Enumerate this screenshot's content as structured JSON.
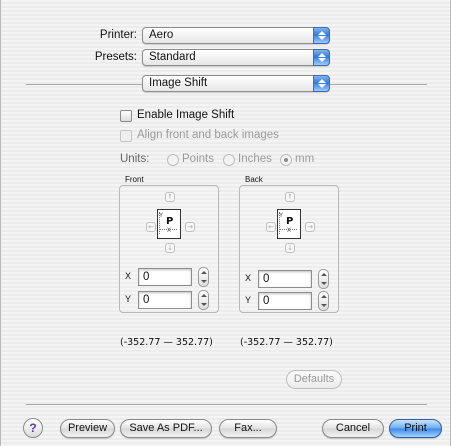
{
  "header": {
    "printer_label": "Printer:",
    "printer_value": "Aero",
    "presets_label": "Presets:",
    "presets_value": "Standard",
    "panel_value": "Image Shift"
  },
  "options": {
    "enable_label": "Enable Image Shift",
    "align_label": "Align front and back images",
    "units_label": "Units:",
    "units": [
      "Points",
      "Inches",
      "mm"
    ],
    "selected_unit": "mm"
  },
  "front": {
    "title": "Front",
    "x_label": "X",
    "x_value": "0",
    "y_label": "Y",
    "y_value": "0",
    "range": "(-352.77  —  352.77)"
  },
  "back": {
    "title": "Back",
    "x_label": "X",
    "x_value": "0",
    "y_label": "Y",
    "y_value": "0",
    "range": "(-352.77  —  352.77)"
  },
  "preview_glyphs": {
    "page_letter": "P",
    "y_axis": "Y",
    "x_axis": "X",
    "up": "↑",
    "down": "↓",
    "left": "←",
    "right": "→"
  },
  "buttons": {
    "defaults": "Defaults",
    "help": "?",
    "preview": "Preview",
    "save_pdf": "Save As PDF...",
    "fax": "Fax...",
    "cancel": "Cancel",
    "print": "Print"
  },
  "colors": {
    "accent_blue": "#3c87e6",
    "help_glyph": "#5a3fa6"
  }
}
